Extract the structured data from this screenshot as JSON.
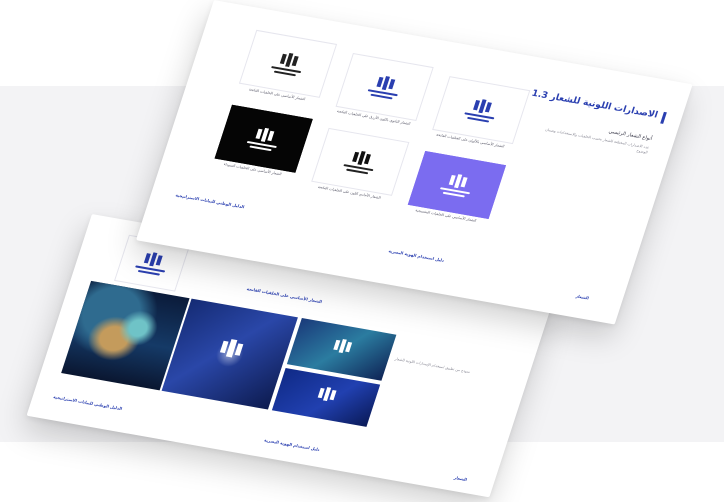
{
  "heading": {
    "number": "1.3",
    "title": "الاصدارات اللونية للشعار"
  },
  "intro": {
    "subtitle": "أنواع الشعار الرئيسي",
    "description": "عدد الاصدارات المختلفة للشعار بحسب الخلفيات والاستخدامات وضمان الوضوح"
  },
  "tiles": [
    {
      "caption": "الشعار الأساسي بالألوان على الخلفيات الفاتحة",
      "style": "color"
    },
    {
      "caption": "الشعار الثانوي باللون الأزرق على الخلفيات الفاتحة",
      "style": "color"
    },
    {
      "caption": "الشعار الأساسي على الخلفيات الفاتحة",
      "style": "mono"
    },
    {
      "caption": "الشعار الأساسي على الخلفيات البنفسجية",
      "style": "purple"
    },
    {
      "caption": "الشعار الأحادي اللون على الخلفيات الفاتحة",
      "style": "mono"
    },
    {
      "caption": "الشعار الأساسي على الخلفيات السوداء",
      "style": "black"
    }
  ],
  "footer_front": {
    "left_link": "الدليل الوطني للبيانات الاستراتيجية",
    "mid_link": "دليل استخدام الهوية البصرية",
    "right_link": "الشعار"
  },
  "back_sheet": {
    "caption": "الشعار الأساسي على الخلفيات الفاتحة",
    "note": "نموذج من تطبيق استخدام الإصدارات اللونية للشعار",
    "left_link": "الدليل الوطني للبيانات الاستراتيجية",
    "mid_link": "دليل استخدام الهوية البصرية",
    "right_link": "الشعار"
  },
  "colors": {
    "brand_blue": "#2a3fb0",
    "purple": "#7b6cf0",
    "black": "#050505",
    "band": "#f3f3f5"
  }
}
